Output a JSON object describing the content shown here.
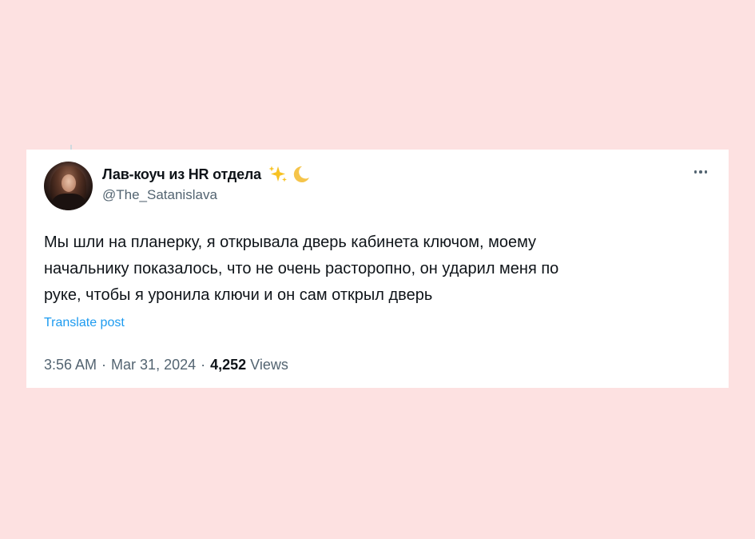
{
  "tweet": {
    "display_name": "Лав-коуч из HR отдела",
    "name_emojis": [
      "sparkles-emoji",
      "crescent-moon-emoji"
    ],
    "handle": "@The_Satanislava",
    "text": "Мы шли на планерку, я открывала дверь кабинета ключом, моему\nначальнику показалось, что не очень расторопно, он ударил меня по\nруке, чтобы я уронила ключи и он сам открыл дверь",
    "translate_label": "Translate post",
    "time": "3:56 AM",
    "date": "Mar 31, 2024",
    "separator": "·",
    "views_count": "4,252",
    "views_label": "Views",
    "more_icon": "more-horizontal-icon"
  },
  "colors": {
    "page_background": "#fde1e1",
    "card_background": "#ffffff",
    "text_primary": "#0f1419",
    "text_secondary": "#536471",
    "link": "#1d9bf0"
  }
}
